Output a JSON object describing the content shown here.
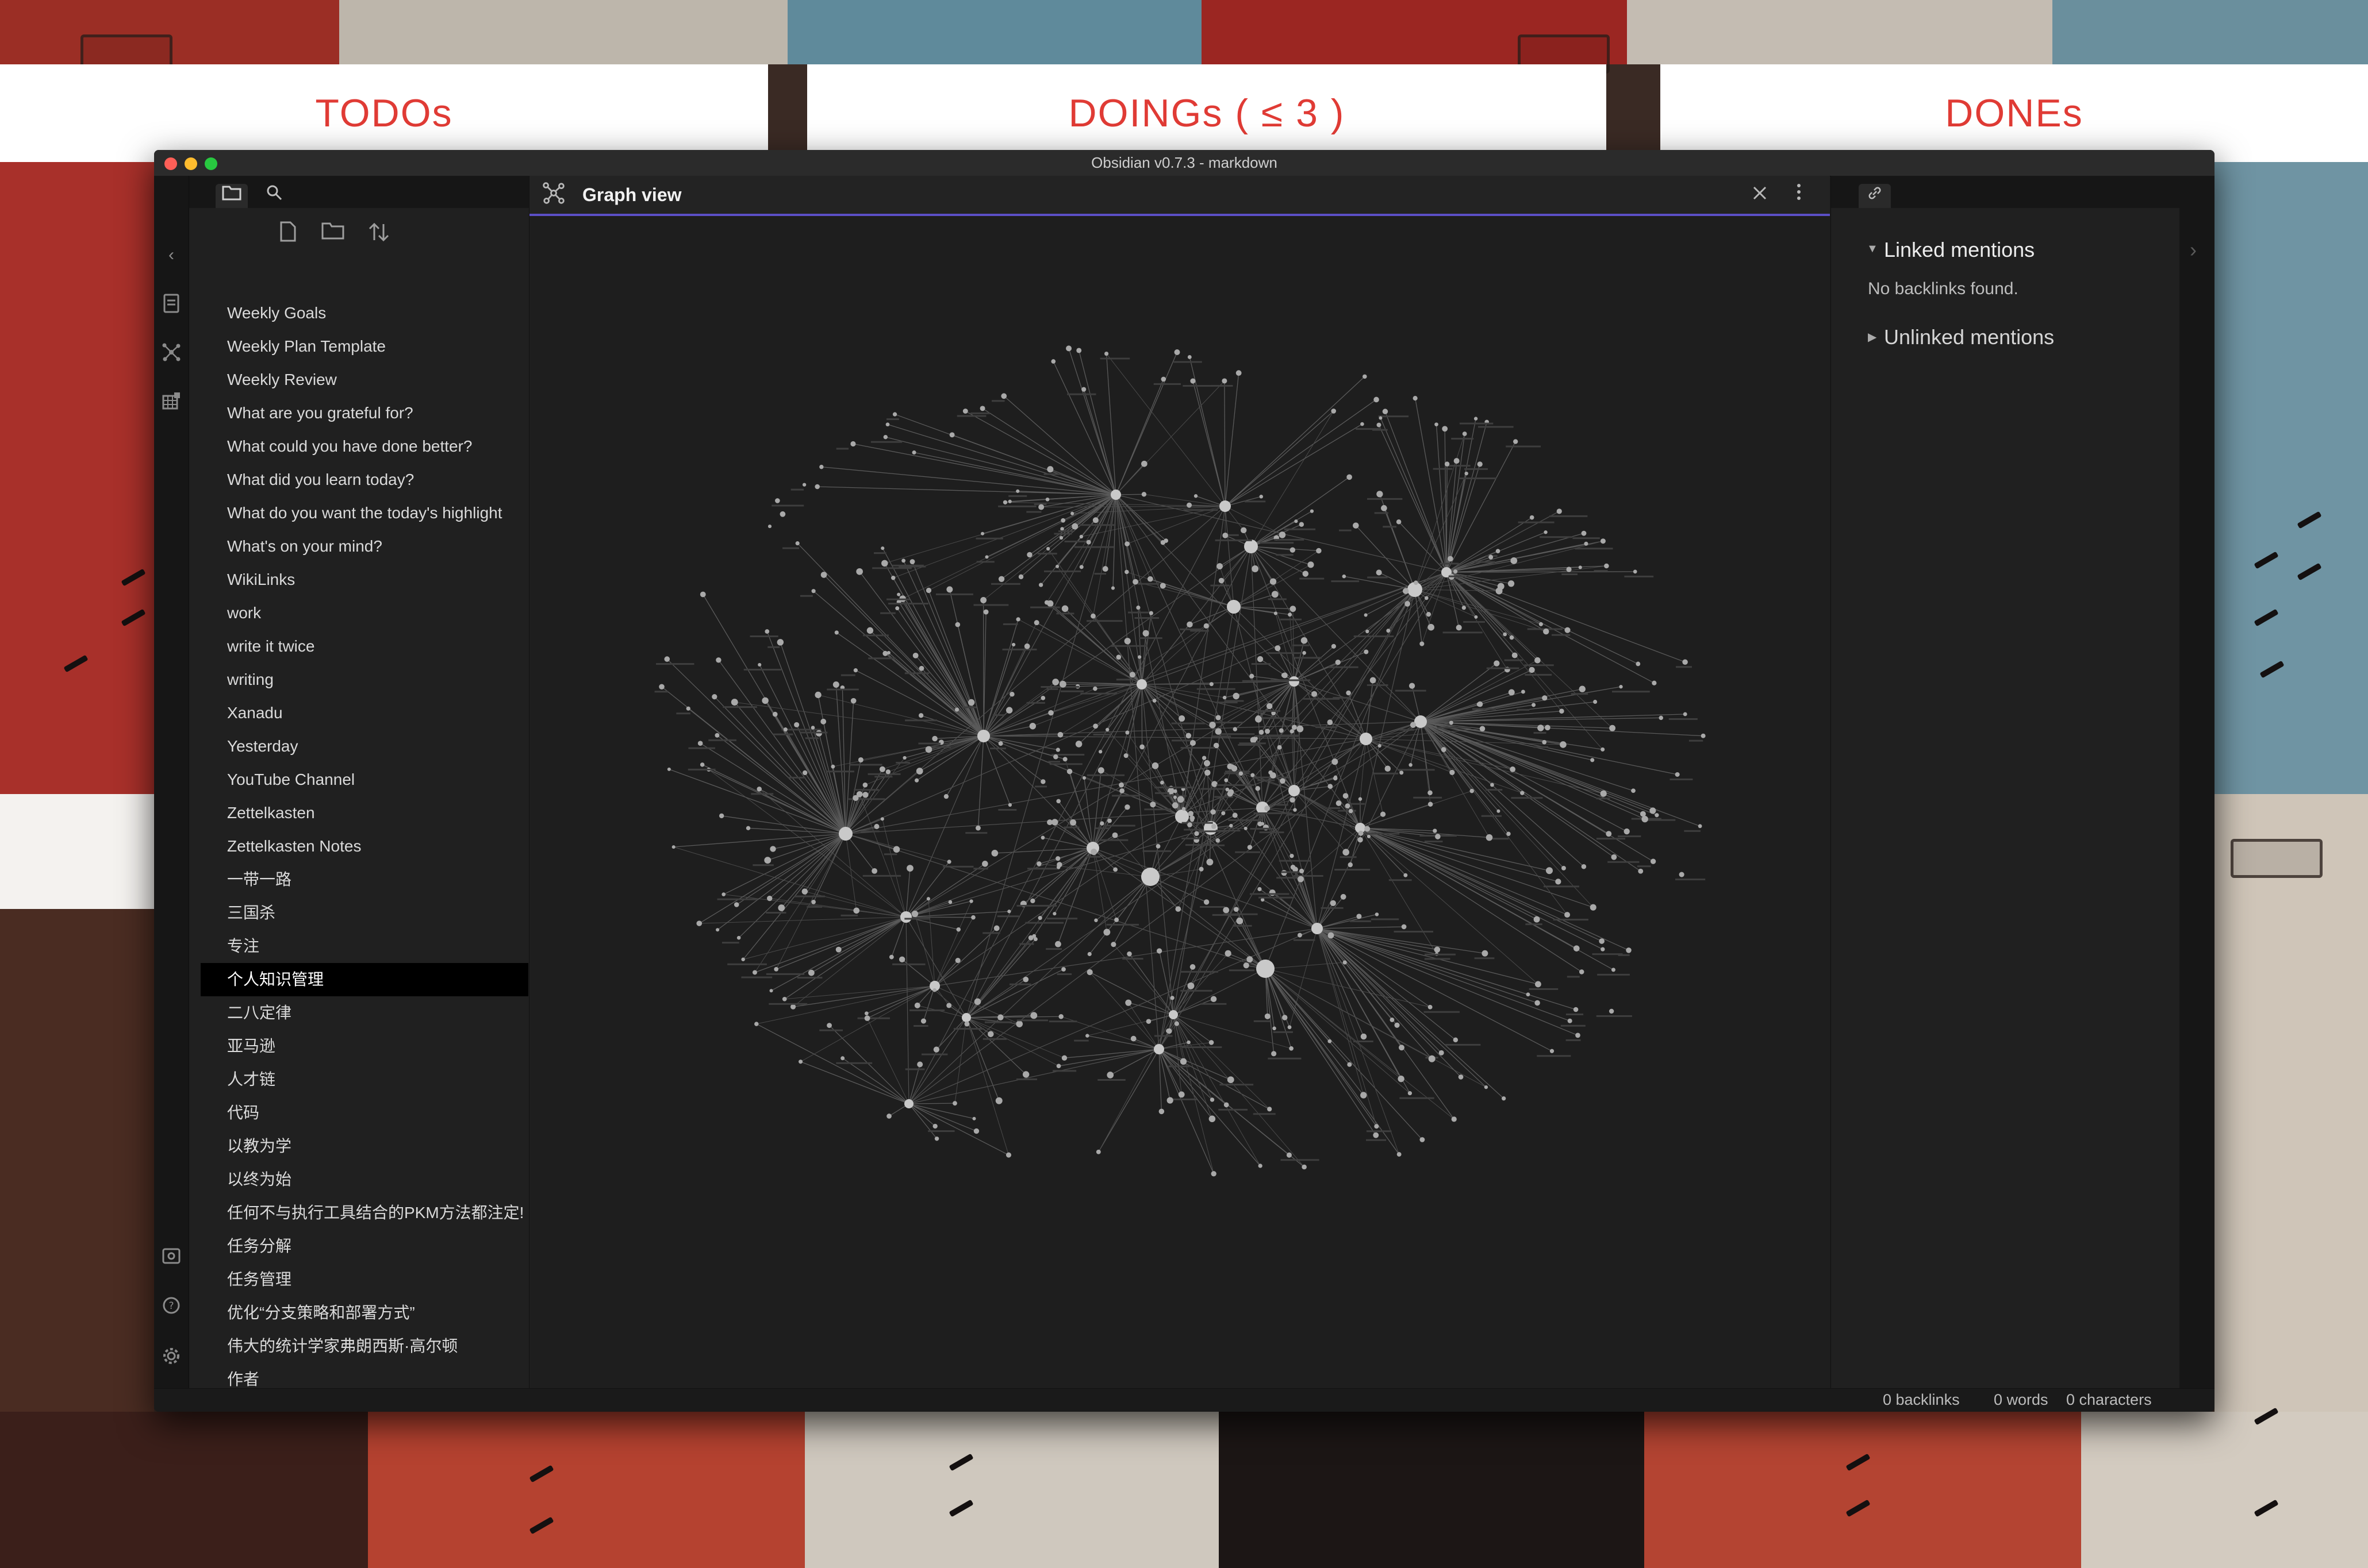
{
  "background": {
    "labels": [
      "TODOs",
      "DOINGs ( ≤ 3 )",
      "DONEs"
    ],
    "label_color": "#e03b35"
  },
  "window": {
    "title": "Obsidian v0.7.3 - markdown",
    "traffic_lights": [
      "#fe5f57",
      "#febc2e",
      "#28c840"
    ],
    "accent": "#5b4fc6"
  },
  "ribbon": {
    "icons": [
      "collapse-left-icon",
      "daily-note-icon",
      "graph-icon",
      "calendar-grid-icon",
      "vault-icon",
      "help-icon",
      "settings-icon"
    ]
  },
  "left_pane": {
    "tabs": [
      "folder-icon",
      "search-icon"
    ],
    "actions": [
      "new-note-icon",
      "new-folder-icon",
      "sort-icon"
    ],
    "files": [
      "Weekly Goals",
      "Weekly Plan Template",
      "Weekly Review",
      "What are you grateful for?",
      "What could you have done better?",
      "What did you learn today?",
      "What do you want the today's highlight",
      "What's on your mind?",
      "WikiLinks",
      "work",
      "write it twice",
      "writing",
      "Xanadu",
      "Yesterday",
      "YouTube Channel",
      "Zettelkasten",
      "Zettelkasten Notes",
      "一带一路",
      "三国杀",
      "专注",
      "个人知识管理",
      "二八定律",
      "亚马逊",
      "人才链",
      "代码",
      "以教为学",
      "以终为始",
      "任何不与执行工具结合的PKM方法都注定!",
      "任务分解",
      "任务管理",
      "优化“分支策略和部署方式”",
      "伟大的统计学家弗朗西斯·高尔顿",
      "作者"
    ],
    "active_file": "个人知识管理"
  },
  "main_pane": {
    "view_title": "Graph view",
    "header_icons": [
      "graph-view-icon",
      "close-icon",
      "more-options-icon"
    ]
  },
  "right_pane": {
    "tab_icon": "link-icon",
    "linked_mentions": "Linked mentions",
    "no_backlinks": "No backlinks found.",
    "unlinked_mentions": "Unlinked mentions"
  },
  "status_bar": {
    "backlinks": "0 backlinks",
    "words": "0 words",
    "characters": "0 characters"
  }
}
